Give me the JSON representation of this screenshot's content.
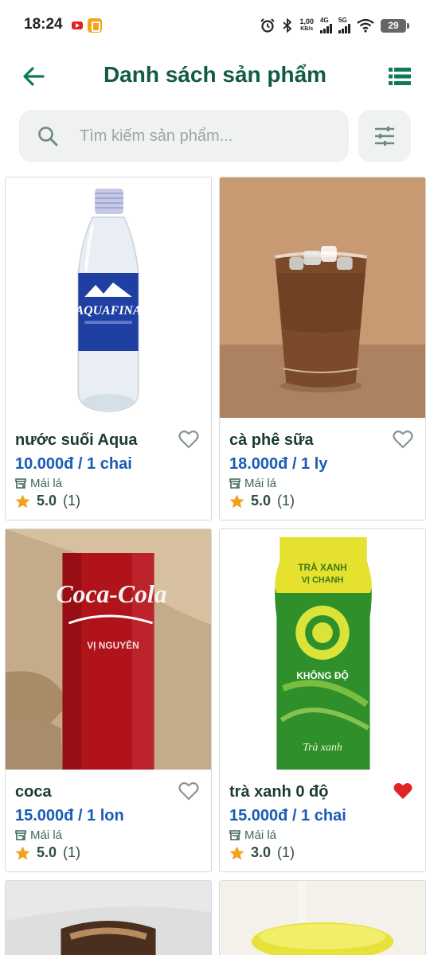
{
  "status_bar": {
    "time": "18:24",
    "net_speed": "1,00",
    "net_speed_unit": "KB/s",
    "sim1_label": "4G",
    "sim2_label": "5G",
    "battery": "29",
    "icons": [
      "youtube-icon",
      "app-notification-icon",
      "alarm-icon",
      "bluetooth-icon",
      "signal-icon",
      "wifi-icon",
      "battery-icon"
    ]
  },
  "header": {
    "title": "Danh sách sản phẩm",
    "back_icon": "arrow-left-icon",
    "view_icon": "list-view-icon"
  },
  "search": {
    "placeholder": "Tìm kiếm sản phẩm...",
    "value": "",
    "icon": "search-icon",
    "filter_icon": "tune-filter-icon"
  },
  "products": [
    {
      "name": "nước suối Aqua",
      "price": "10.000đ / 1 chai",
      "store": "Mái lá",
      "rating": "5.0",
      "reviews": "(1)",
      "favorite": false
    },
    {
      "name": "cà phê sữa",
      "price": "18.000đ / 1 ly",
      "store": "Mái lá",
      "rating": "5.0",
      "reviews": "(1)",
      "favorite": false
    },
    {
      "name": "coca",
      "price": "15.000đ / 1 lon",
      "store": "Mái lá",
      "rating": "5.0",
      "reviews": "(1)",
      "favorite": false
    },
    {
      "name": "trà xanh 0 độ",
      "price": "15.000đ / 1 chai",
      "store": "Mái lá",
      "rating": "3.0",
      "reviews": "(1)",
      "favorite": true
    }
  ],
  "image_text": {
    "aquafina": "AQUAFINA",
    "coca_brand": "Coca-Cola",
    "coca_sub": "VỊ NGUYÊN",
    "tea_top": "TRÀ XANH",
    "tea_top2": "VỊ CHANH",
    "tea_zero": "KHÔNG ĐỘ",
    "tea_bottom": "Trà xanh"
  },
  "colors": {
    "title": "#115b45",
    "price": "#1a5bb5",
    "star": "#f2a21b",
    "favorite_active": "#e02424",
    "icon_green": "#0f7a5a"
  }
}
